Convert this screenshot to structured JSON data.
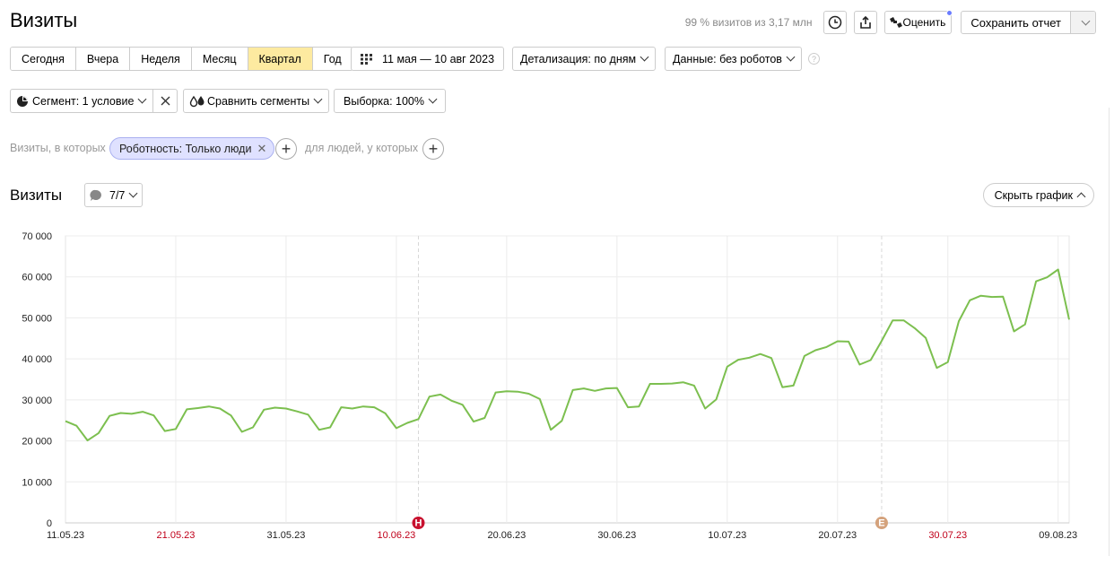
{
  "header": {
    "title": "Визиты",
    "quota": "99 % визитов из 3,17 млн",
    "rate_label": "Оценить",
    "save_label": "Сохранить отчет"
  },
  "periods": [
    {
      "label": "Сегодня",
      "active": false
    },
    {
      "label": "Вчера",
      "active": false
    },
    {
      "label": "Неделя",
      "active": false
    },
    {
      "label": "Месяц",
      "active": false
    },
    {
      "label": "Квартал",
      "active": true
    },
    {
      "label": "Год",
      "active": false
    }
  ],
  "toolbar": {
    "date_range": "11 мая — 10 авг 2023",
    "detail": "Детализация: по дням",
    "data": "Данные: без роботов",
    "segment": "Сегмент: 1 условие",
    "compare": "Сравнить сегменты",
    "sample": "Выборка: 100%"
  },
  "filters": {
    "visits_label": "Визиты, в которых",
    "chip": "Роботность: Только люди",
    "people_label": "для людей, у которых"
  },
  "chart_section": {
    "title": "Визиты",
    "annotations": "7/7",
    "hide_label": "Скрыть график"
  },
  "colors": {
    "line": "#7cbf4f",
    "active_period": "#fdeaa0",
    "holiday": "#c0001a",
    "marker_h": "#c8102e",
    "marker_e": "#d4a27c"
  },
  "chart_data": {
    "type": "line",
    "ylim": [
      0,
      70000
    ],
    "yticks": [
      "0",
      "10 000",
      "20 000",
      "30 000",
      "40 000",
      "50 000",
      "60 000",
      "70 000"
    ],
    "xticks": [
      {
        "label": "11.05.23",
        "index": 0,
        "holiday": false
      },
      {
        "label": "21.05.23",
        "index": 10,
        "holiday": true
      },
      {
        "label": "31.05.23",
        "index": 20,
        "holiday": false
      },
      {
        "label": "10.06.23",
        "index": 30,
        "holiday": true
      },
      {
        "label": "20.06.23",
        "index": 40,
        "holiday": false
      },
      {
        "label": "30.06.23",
        "index": 50,
        "holiday": false
      },
      {
        "label": "10.07.23",
        "index": 60,
        "holiday": false
      },
      {
        "label": "20.07.23",
        "index": 70,
        "holiday": false
      },
      {
        "label": "30.07.23",
        "index": 80,
        "holiday": true
      },
      {
        "label": "09.08.23",
        "index": 90,
        "holiday": false
      }
    ],
    "markers": [
      {
        "label": "Н",
        "index": 32,
        "color": "#c8102e"
      },
      {
        "label": "Е",
        "index": 74,
        "color": "#d4a27c"
      }
    ],
    "series": [
      {
        "values": [
          24800,
          23700,
          20100,
          21900,
          26100,
          26800,
          26600,
          27100,
          26200,
          22400,
          22900,
          27700,
          28000,
          28400,
          27900,
          26200,
          22200,
          23300,
          27600,
          28100,
          27900,
          27200,
          26400,
          22700,
          23300,
          28200,
          27900,
          28400,
          28200,
          26700,
          23100,
          24400,
          25300,
          30800,
          31300,
          29800,
          28800,
          24700,
          25600,
          31800,
          32100,
          32000,
          31500,
          30200,
          22700,
          24900,
          32400,
          32800,
          32200,
          32800,
          32900,
          28200,
          28400,
          33900,
          33900,
          34000,
          34300,
          33500,
          27900,
          30100,
          38100,
          39800,
          40300,
          41200,
          40200,
          33100,
          33500,
          40700,
          42100,
          42900,
          44300,
          44200,
          38600,
          39700,
          44400,
          49400,
          49400,
          47500,
          45100,
          37800,
          39200,
          49200,
          54300,
          55400,
          55100,
          55200,
          46700,
          48400,
          58900,
          59900,
          61800,
          49600
        ]
      }
    ]
  }
}
